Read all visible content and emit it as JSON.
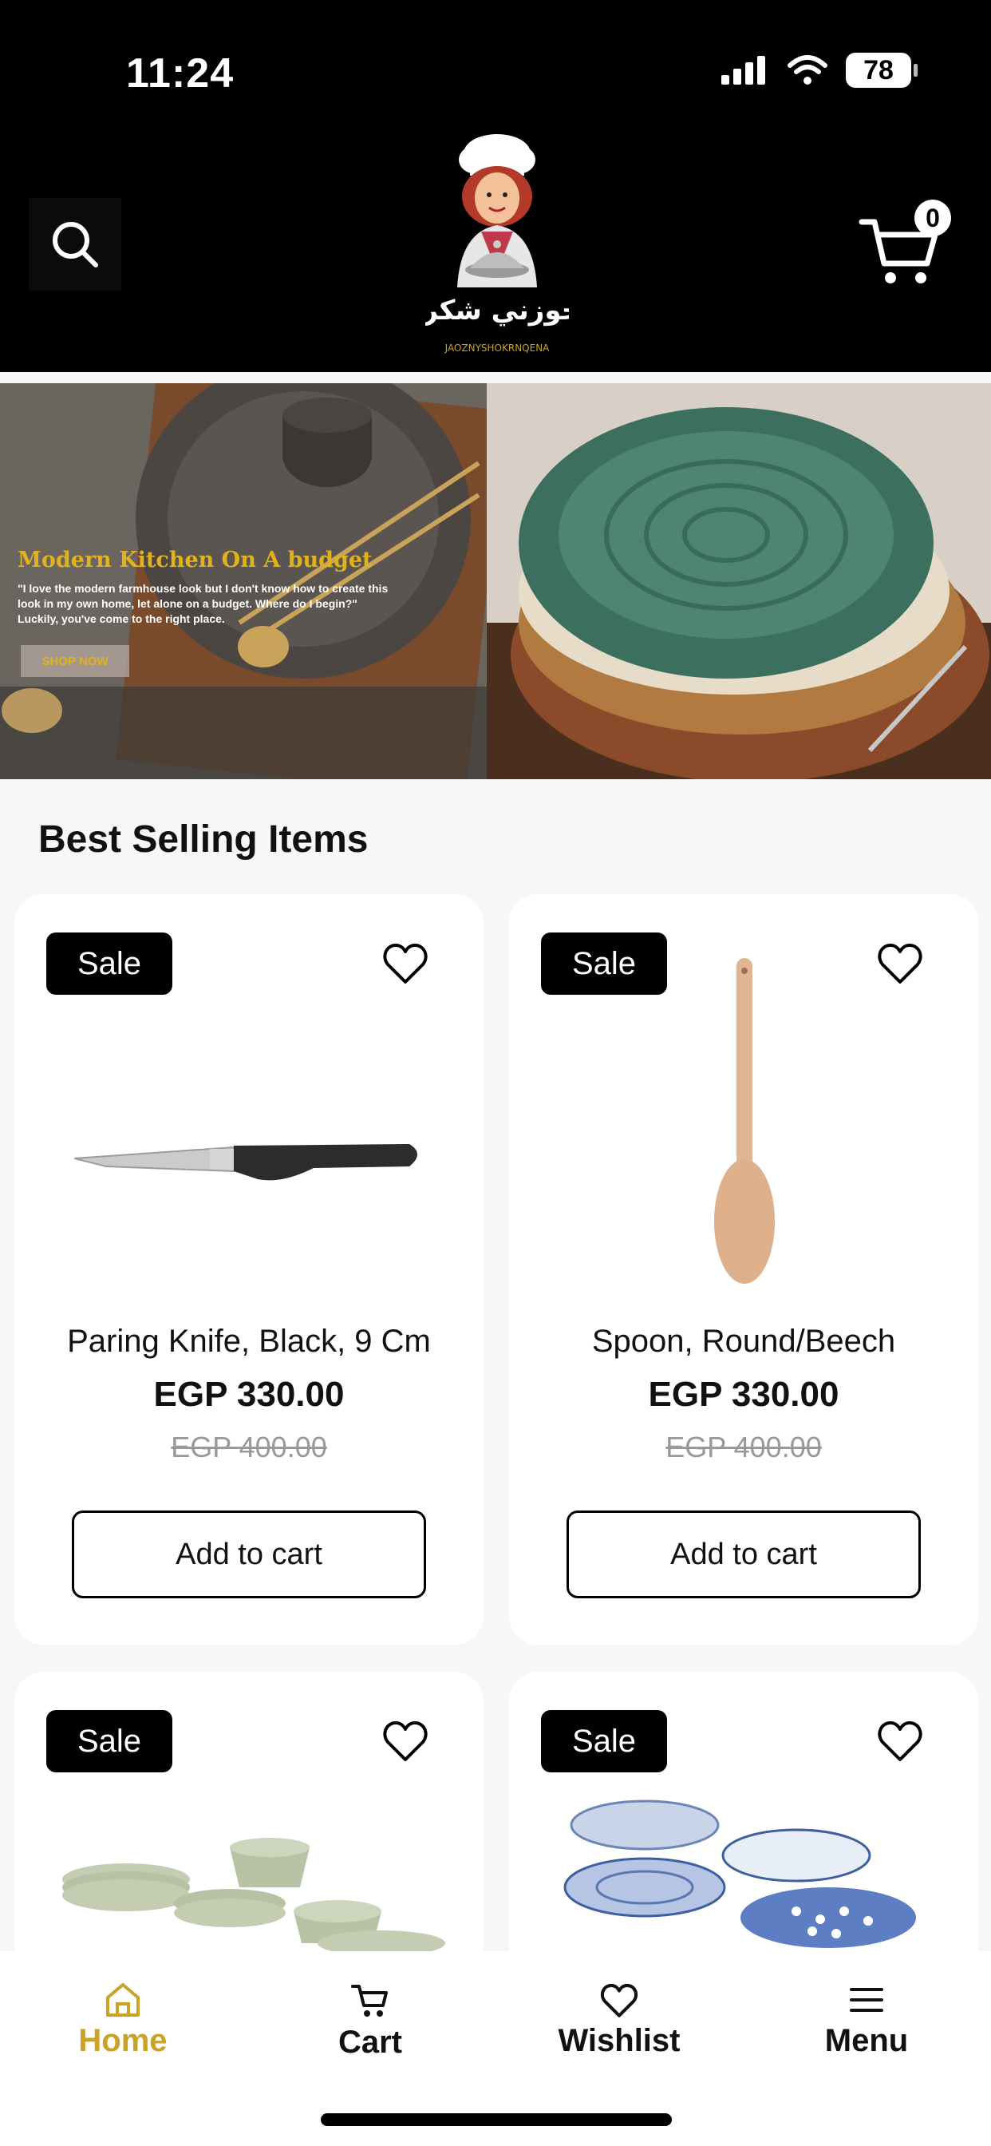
{
  "status_bar": {
    "time": "11:24",
    "battery": "78"
  },
  "header": {
    "logo_text_ar": "جوزني شكرا",
    "logo_caption": "JAOZNYSHOKRNQENA",
    "cart_count": "0"
  },
  "banner": {
    "title": "Modern Kitchen On A budget",
    "text": "\"I love the modern farmhouse look but I don't know how to create this look in my own home, let alone on a budget. Where do I begin?\" Luckily, you've come to the right place.",
    "button": "SHOP NOW"
  },
  "section": {
    "title": "Best Selling Items"
  },
  "products": [
    {
      "badge": "Sale",
      "name": "Paring Knife, Black, 9 Cm",
      "price": "EGP 330.00",
      "old_price": "EGP 400.00",
      "button": "Add to cart"
    },
    {
      "badge": "Sale",
      "name": "Spoon, Round/Beech",
      "price": "EGP 330.00",
      "old_price": "EGP 400.00",
      "button": "Add to cart"
    },
    {
      "badge": "Sale"
    },
    {
      "badge": "Sale"
    }
  ],
  "nav": {
    "home": "Home",
    "cart": "Cart",
    "wishlist": "Wishlist",
    "menu": "Menu"
  },
  "colors": {
    "accent": "#c9a227",
    "black": "#000000"
  }
}
